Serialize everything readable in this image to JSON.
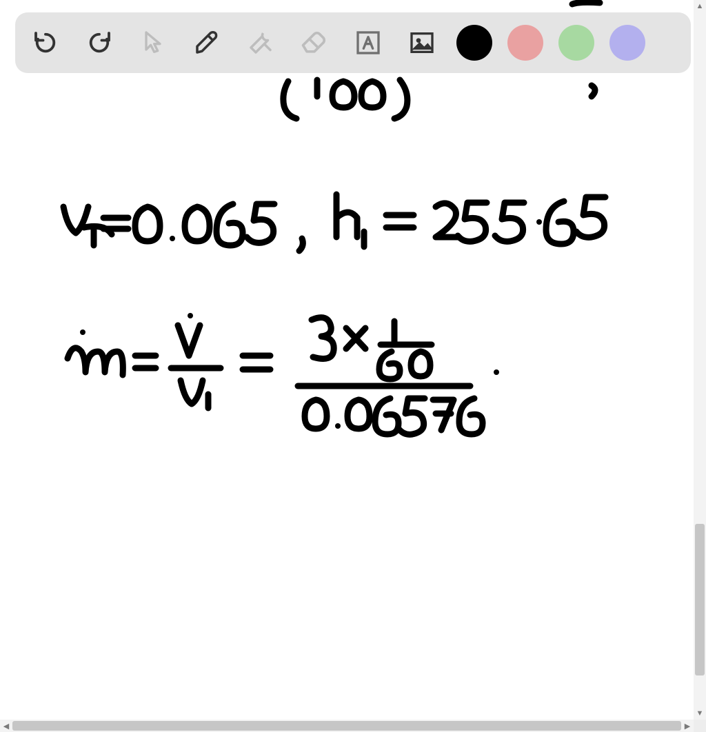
{
  "toolbar": {
    "undo": "Undo",
    "redo": "Redo",
    "pointer": "Pointer",
    "pen": "Pen",
    "tools": "Tools",
    "eraser": "Eraser",
    "text": "Text",
    "image": "Image"
  },
  "colors": {
    "black": "#000000",
    "pink": "#e9a1a1",
    "green": "#a7d9a1",
    "purple": "#b3b0ee",
    "selected": "black"
  },
  "handwriting": {
    "line0": "(100)",
    "line1": "v₁=0.065 , h₁ = 255·65",
    "line2": "ṁ = V̇ / v₁ = (3 × 1/60) / 0.06576"
  }
}
